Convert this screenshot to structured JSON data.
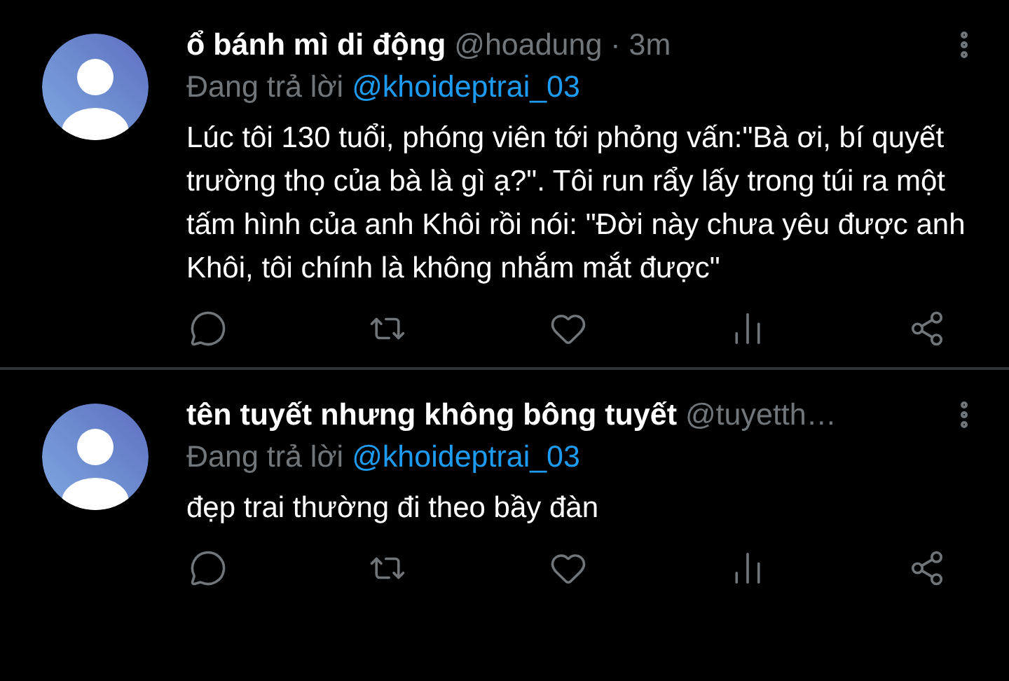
{
  "tweets": [
    {
      "name": "ổ bánh mì di động",
      "handle": "@hoadung",
      "time": "· 3m",
      "reply_prefix": "Đang trả lời",
      "reply_to": "@khoideptrai_03",
      "text": "Lúc tôi 130 tuổi, phóng viên tới phỏng vấn:\"Bà ơi, bí quyết trường thọ của bà là gì ạ?\". Tôi run rẩy lấy trong túi ra một tấm hình của anh Khôi rồi nói: \"Đời này chưa yêu được anh Khôi, tôi chính là không nhắm mắt được\""
    },
    {
      "name": "tên tuyết nhưng không bông tuyết",
      "handle": "@tuyetth…",
      "reply_prefix": "Đang trả lời",
      "reply_to": "@khoideptrai_03",
      "text": "đẹp trai thường đi theo bầy đàn"
    }
  ]
}
